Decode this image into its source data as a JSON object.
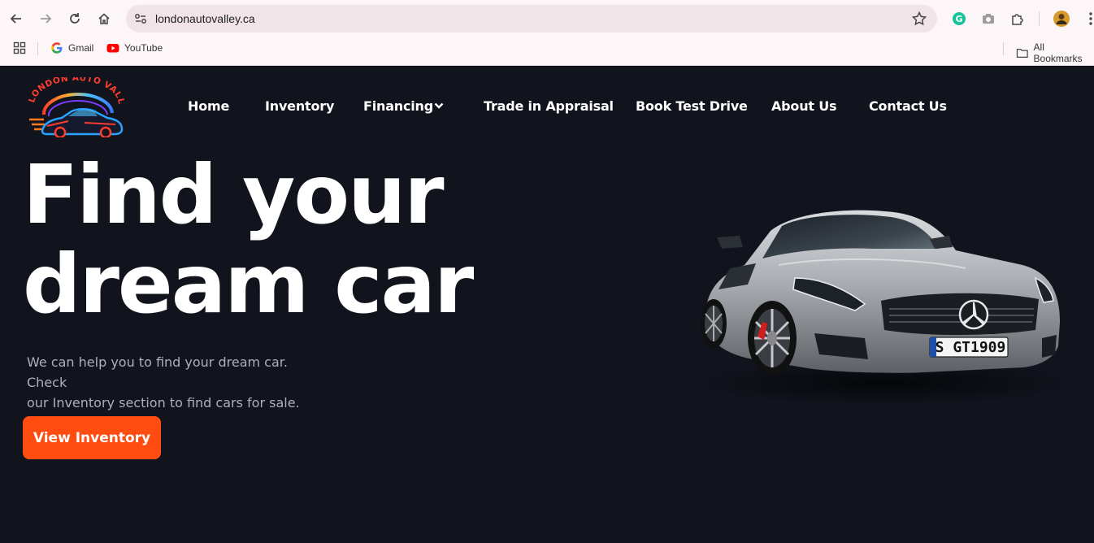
{
  "browser": {
    "url": "londonautovalley.ca",
    "bookmarks": [
      {
        "label": "Gmail",
        "icon": "google-icon"
      },
      {
        "label": "YouTube",
        "icon": "youtube-icon"
      }
    ],
    "all_bookmarks": "All Bookmarks"
  },
  "site": {
    "logo_text": "LONDON AUTO VALLEY",
    "nav": [
      {
        "label": "Home"
      },
      {
        "label": "Inventory"
      },
      {
        "label": "Financing"
      },
      {
        "label": "Trade in Appraisal"
      },
      {
        "label": "Book Test Drive"
      },
      {
        "label": "About Us"
      },
      {
        "label": "Contact Us"
      }
    ],
    "hero": {
      "title_line1": "Find your",
      "title_line2": "dream car",
      "subtitle_line1": "We can help you to find your dream car. Check",
      "subtitle_line2": "our Inventory section to find cars for sale.",
      "cta_label": "View Inventory"
    },
    "car_plate": "S GT1909"
  },
  "colors": {
    "background": "#11141d",
    "accent": "#ff4d12",
    "text": "#ffffff",
    "muted": "#aab0bf"
  }
}
